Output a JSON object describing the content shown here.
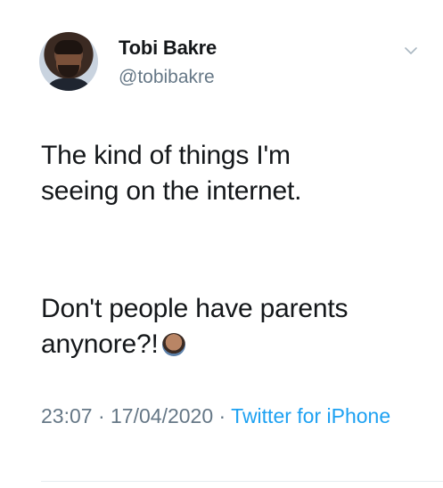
{
  "tweet": {
    "author": {
      "name": "Tobi Bakre",
      "handle": "@tobibakre"
    },
    "icons": {
      "menu": "chevron-down-icon",
      "emoji": "person-facepalming-emoji-icon"
    },
    "text": {
      "line1": "The kind of things I'm",
      "line2": "seeing on the internet.",
      "line3": "Don't people have parents",
      "line4": "anynore?!"
    },
    "meta": {
      "time": "23:07",
      "separator1": " · ",
      "date": "17/04/2020",
      "separator2": " · ",
      "source": "Twitter for iPhone"
    },
    "colors": {
      "text": "#14171a",
      "secondary": "#657786",
      "link": "#1da1f2",
      "divider": "#e6ecf0"
    }
  }
}
